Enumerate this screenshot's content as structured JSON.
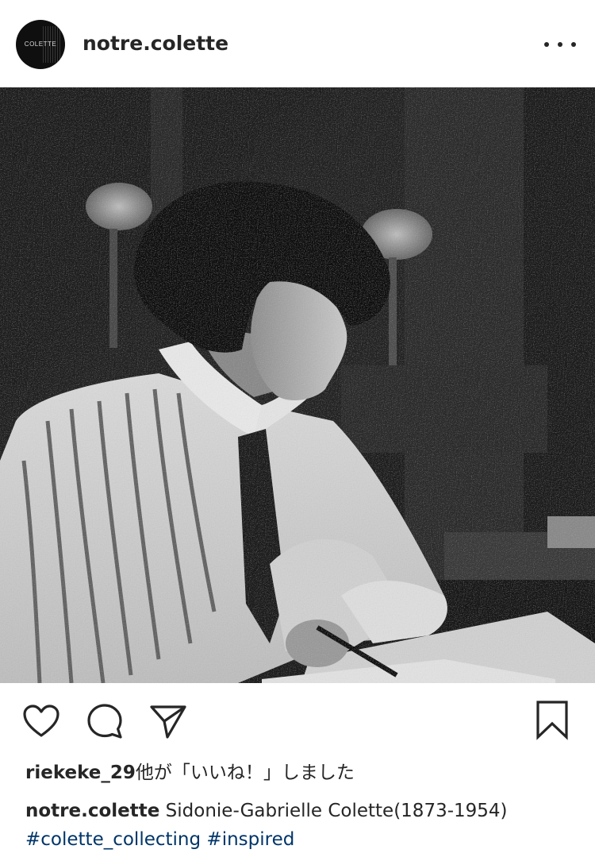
{
  "header": {
    "avatar_text": "COLETTE",
    "username": "notre.colette",
    "more_icon": "more-horizontal-icon"
  },
  "photo": {
    "description_icon": "photo"
  },
  "actions": {
    "like_icon": "heart-outline-icon",
    "comment_icon": "comment-bubble-icon",
    "share_icon": "paper-plane-icon",
    "save_icon": "bookmark-outline-icon"
  },
  "likes": {
    "liker": "riekeke_29",
    "suffix": "他が「いいね！」しました"
  },
  "caption": {
    "username": "notre.colette",
    "text": "Sidonie-Gabrielle Colette(1873-1954)",
    "hashtags": [
      "#colette_collecting",
      "#inspired"
    ]
  },
  "colors": {
    "text": "#262626",
    "hashtag": "#003569",
    "background": "#ffffff"
  }
}
